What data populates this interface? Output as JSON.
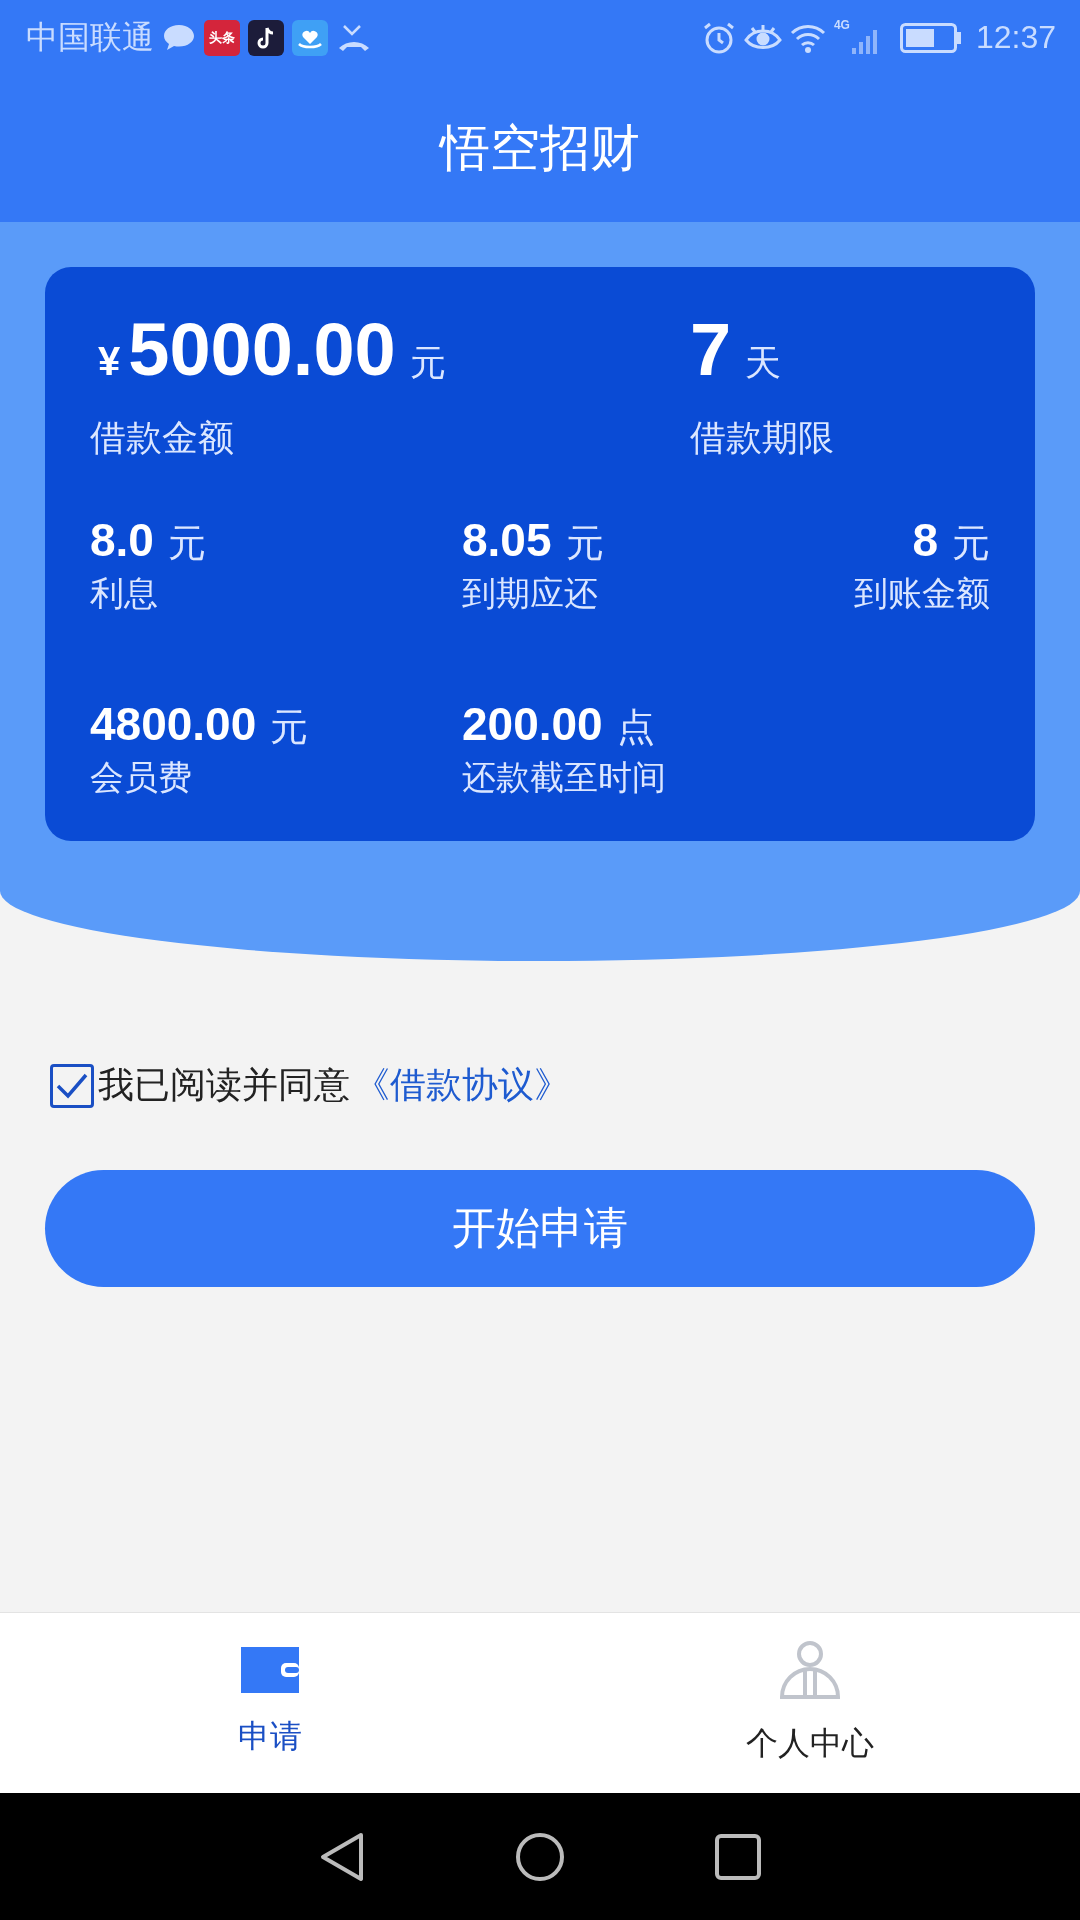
{
  "status_bar": {
    "carrier": "中国联通",
    "notifications": [
      {
        "kind": "chat"
      },
      {
        "kind": "news",
        "label": "头条"
      },
      {
        "kind": "music"
      },
      {
        "kind": "heart"
      },
      {
        "kind": "missed-call"
      }
    ],
    "network": "4G",
    "time": "12:37"
  },
  "header": {
    "title": "悟空招财"
  },
  "loan": {
    "amount": {
      "currency": "¥",
      "value": "5000.00",
      "unit": "元",
      "label": "借款金额"
    },
    "term": {
      "value": "7",
      "unit": "天",
      "label": "借款期限"
    },
    "details": [
      {
        "value": "8.0",
        "unit": "元",
        "label": "利息"
      },
      {
        "value": "8.05",
        "unit": "元",
        "label": "到期应还"
      },
      {
        "value": "8",
        "unit": "元",
        "label": "到账金额"
      },
      {
        "value": "4800.00",
        "unit": "元",
        "label": "会员费"
      },
      {
        "value": "200.00",
        "unit": "点",
        "label": "还款截至时间"
      }
    ]
  },
  "agreement": {
    "checked": true,
    "text": "我已阅读并同意",
    "link": "《借款协议》"
  },
  "apply_button": "开始申请",
  "tabs": [
    {
      "kind": "wallet",
      "label": "申请",
      "selected": true
    },
    {
      "kind": "person",
      "label": "个人中心",
      "selected": false
    }
  ]
}
